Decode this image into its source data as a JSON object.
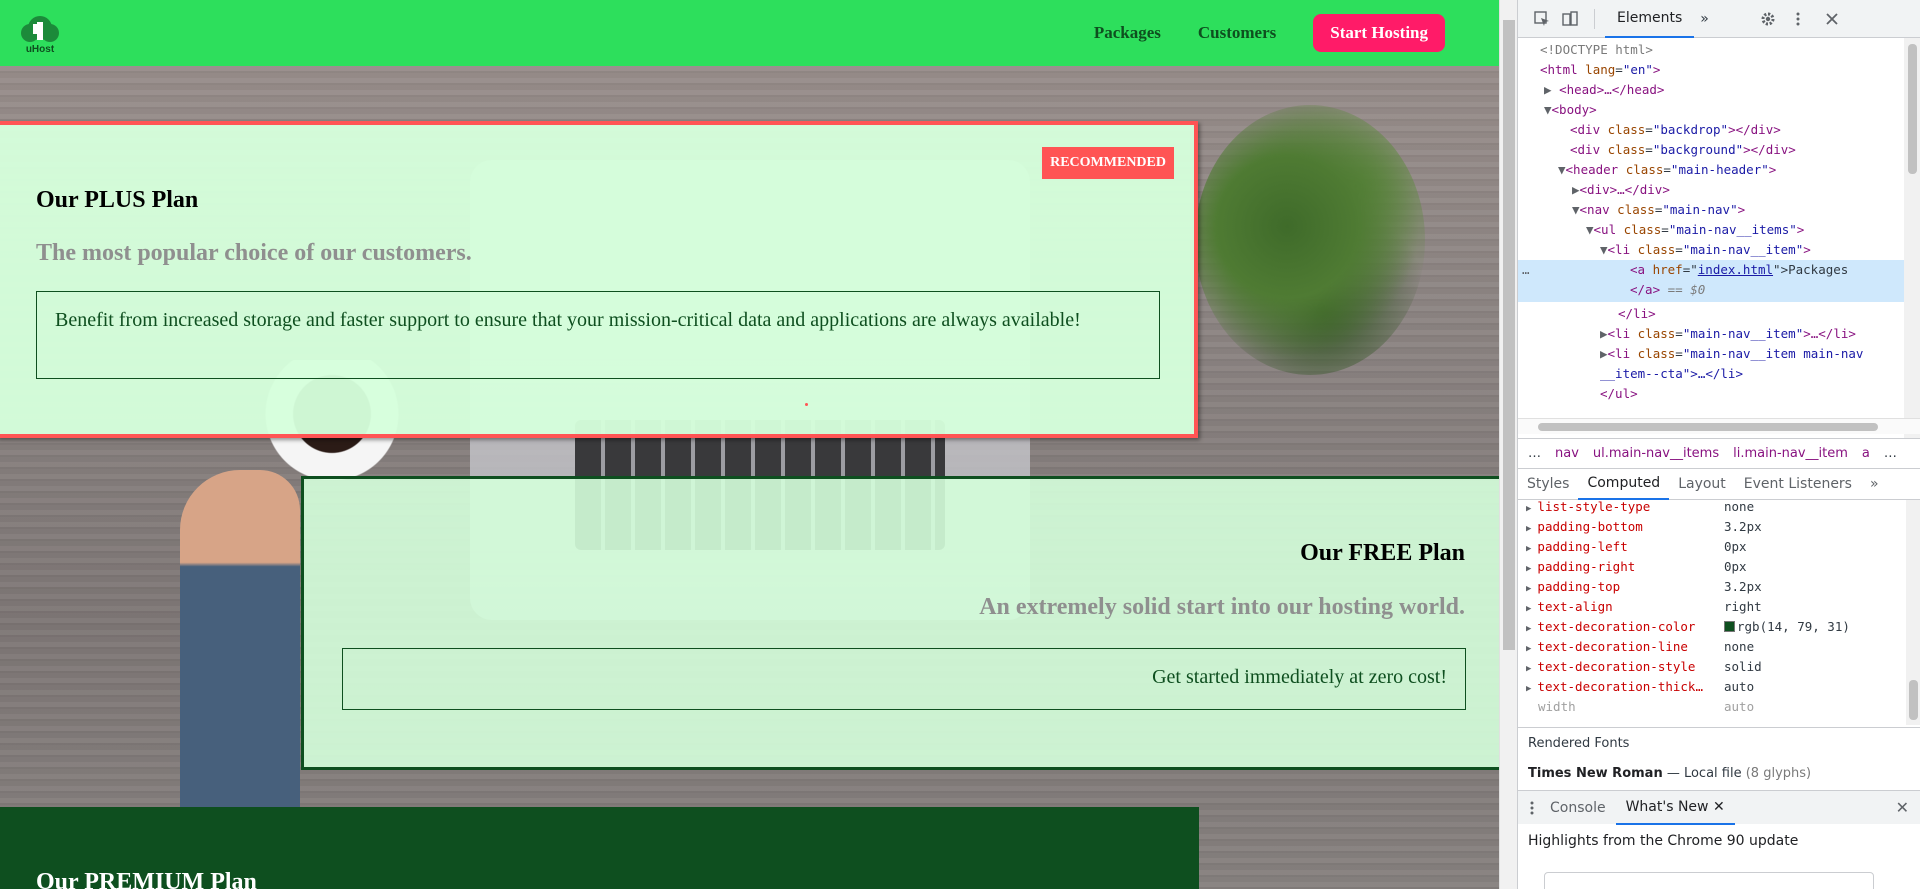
{
  "header": {
    "nav_items": [
      "Packages",
      "Customers"
    ],
    "cta_label": "Start Hosting",
    "logo_text": "uHost"
  },
  "plans": {
    "plus": {
      "badge": "RECOMMENDED",
      "title": "Our PLUS Plan",
      "subtitle": "The most popular choice of our customers.",
      "description": "Benefit from increased storage and faster support to ensure that your mission-critical data and applications are always available!"
    },
    "free": {
      "title": "Our FREE Plan",
      "subtitle": "An extremely solid start into our hosting world.",
      "description": "Get started immediately at zero cost!"
    },
    "premium": {
      "title": "Our PREMIUM Plan"
    }
  },
  "devtools": {
    "tabs": {
      "elements": "Elements",
      "more": "»"
    },
    "dom": [
      {
        "text": "<!DOCTYPE html>"
      },
      {
        "tag_open": "<html",
        "attr": "lang",
        "value": "\"en\"",
        "tag_close": ">"
      },
      {
        "text": "<head>…</head>"
      },
      {
        "text": "<body>"
      },
      {
        "tag_open": "<div",
        "attr": "class",
        "value": "\"backdrop\"",
        "tag_close": "></div>"
      },
      {
        "tag_open": "<div",
        "attr": "class",
        "value": "\"background\"",
        "tag_close": "></div>"
      },
      {
        "tag_open": "<header",
        "attr": "class",
        "value": "\"main-header\"",
        "tag_close": ">"
      },
      {
        "text": "<div>…</div>"
      },
      {
        "tag_open": "<nav",
        "attr": "class",
        "value": "\"main-nav\"",
        "tag_close": ">"
      },
      {
        "tag_open": "<ul",
        "attr": "class",
        "value": "\"main-nav__items\"",
        "tag_close": ">"
      },
      {
        "tag_open": "<li",
        "attr": "class",
        "value": "\"main-nav__item\"",
        "tag_close": ">"
      },
      {
        "tag_open": "<a",
        "attr": "href",
        "value": "index.html",
        "tag_close": ">Packages"
      },
      {
        "text": "</a>",
        "suffix": " == $0"
      },
      {
        "text": "</li>"
      },
      {
        "tag_open": "<li",
        "attr": "class",
        "value": "\"main-nav__item\"",
        "tag_close": ">…</li>"
      },
      {
        "tag_open": "<li",
        "attr": "class",
        "value": "\"main-nav__item main-nav",
        "tag_close": ""
      },
      {
        "text": "__item--cta\">…</li>"
      },
      {
        "text": "</ul>"
      }
    ],
    "breadcrumbs": [
      "…",
      "nav",
      "ul.main-nav__items",
      "li.main-nav__item",
      "a",
      "…"
    ],
    "subtabs": [
      "Styles",
      "Computed",
      "Layout",
      "Event Listeners",
      "»"
    ],
    "computed": [
      {
        "name": "list-style-type",
        "value": "none"
      },
      {
        "name": "padding-bottom",
        "value": "3.2px"
      },
      {
        "name": "padding-left",
        "value": "0px"
      },
      {
        "name": "padding-right",
        "value": "0px"
      },
      {
        "name": "padding-top",
        "value": "3.2px"
      },
      {
        "name": "text-align",
        "value": "right"
      },
      {
        "name": "text-decoration-color",
        "value": "rgb(14, 79, 31)",
        "swatch": "#0e4f1f"
      },
      {
        "name": "text-decoration-line",
        "value": "none"
      },
      {
        "name": "text-decoration-style",
        "value": "solid"
      },
      {
        "name": "text-decoration-thick…",
        "value": "auto"
      },
      {
        "name": "width",
        "value": "auto",
        "dim": true
      }
    ],
    "rendered_fonts_title": "Rendered Fonts",
    "rendered_font": {
      "name": "Times New Roman",
      "source": "Local file",
      "glyphs": "(8 glyphs)"
    },
    "drawer_tabs": [
      "Console",
      "What's New"
    ],
    "highlights": "Highlights from the Chrome 90 update"
  },
  "colors": {
    "header_green": "#2ddf5c",
    "cta_pink": "#ff1b68",
    "plus_border": "#ff5454",
    "dark_green": "#0e4f1f",
    "card_bg": "#d5ffdc"
  }
}
